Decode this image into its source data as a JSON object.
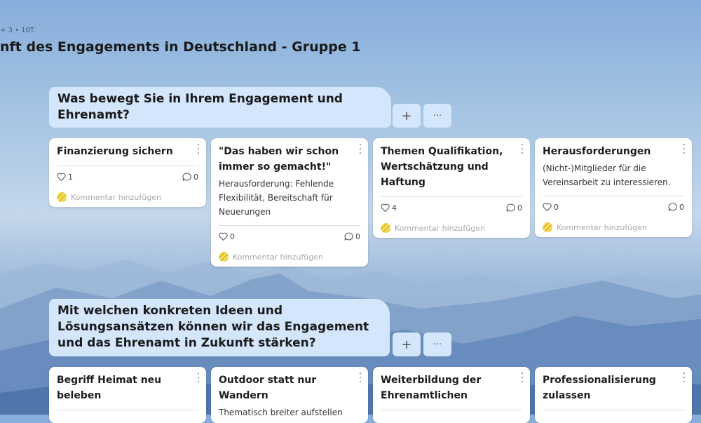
{
  "meta": "+ 3  • 10T.",
  "page_title": "nft des Engagements in Deutschland - Gruppe 1",
  "actions": {
    "add_label": "+",
    "more_label": "···"
  },
  "sections": [
    {
      "heading": "Was bewegt Sie in Ihrem Engagement und Ehrenamt?",
      "cards": [
        {
          "title": "Finanzierung sichern",
          "body": "",
          "likes": "1",
          "comments": "0",
          "comment_placeholder": "Kommentar hinzufügen"
        },
        {
          "title": "\"Das haben wir schon immer so gemacht!\"",
          "body": "Herausforderung: Fehlende Flexibilität, Bereitschaft für Neuerungen",
          "likes": "0",
          "comments": "0",
          "comment_placeholder": "Kommentar hinzufügen"
        },
        {
          "title": "Themen Qualifikation, Wertschätzung und Haftung",
          "body": "",
          "likes": "4",
          "comments": "0",
          "comment_placeholder": "Kommentar hinzufügen"
        },
        {
          "title": "Herausforderungen",
          "body": "(Nicht-)Mitglieder für die Vereinsarbeit zu interessieren.",
          "likes": "0",
          "comments": "0",
          "comment_placeholder": "Kommentar hinzufügen"
        }
      ]
    },
    {
      "heading": "Mit welchen konkreten Ideen und Lösungsansätzen können wir das Engagement und das Ehrenamt in Zukunft stärken?",
      "cards": [
        {
          "title": "Begriff Heimat neu beleben",
          "body": ""
        },
        {
          "title": "Outdoor statt nur Wandern",
          "body": "Thematisch breiter aufstellen"
        },
        {
          "title": "Weiterbildung der Ehrenamtlichen",
          "body": ""
        },
        {
          "title": "Professionalisierung zulassen",
          "body": ""
        }
      ]
    }
  ]
}
